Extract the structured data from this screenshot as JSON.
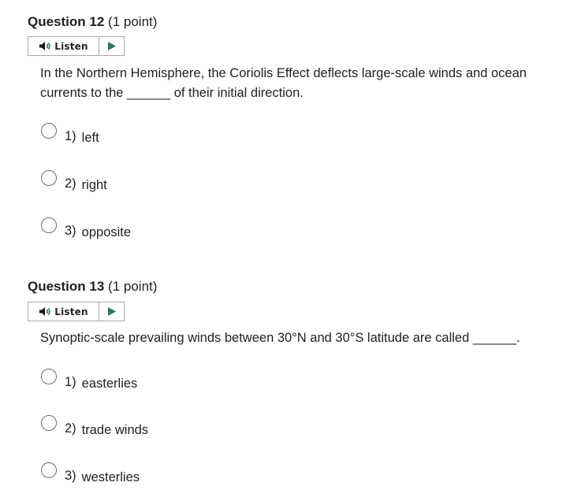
{
  "questions": [
    {
      "number": "Question 12",
      "points": "(1 point)",
      "listen_label": "Listen",
      "text": "In the Northern Hemisphere, the Coriolis Effect deflects large-scale winds and ocean currents to the ______ of their initial direction.",
      "options": [
        {
          "num": "1)",
          "label": "left",
          "selected": false
        },
        {
          "num": "2)",
          "label": "right",
          "selected": false
        },
        {
          "num": "3)",
          "label": "opposite",
          "selected": false
        }
      ]
    },
    {
      "number": "Question 13",
      "points": "(1 point)",
      "listen_label": "Listen",
      "text": "Synoptic-scale prevailing winds between 30°N and 30°S latitude are called ______.",
      "options": [
        {
          "num": "1)",
          "label": "easterlies",
          "selected": false
        },
        {
          "num": "2)",
          "label": "trade winds",
          "selected": false
        },
        {
          "num": "3)",
          "label": "westerlies",
          "selected": false
        }
      ]
    }
  ],
  "icons": {
    "speaker": "speaker-icon",
    "play": "play-icon",
    "accent_color": "#2b7a55"
  }
}
